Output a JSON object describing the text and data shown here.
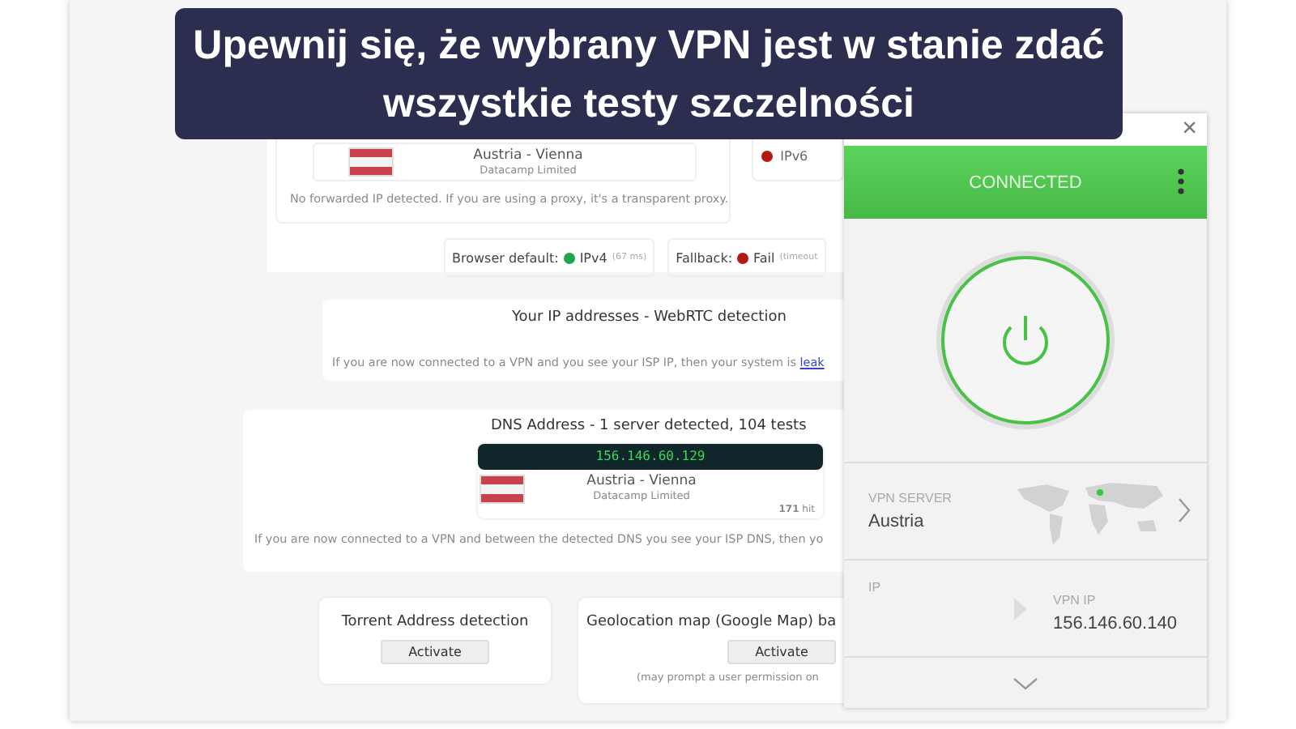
{
  "banner": {
    "text": "Upewnij się, że wybrany VPN jest w stanie zdać wszystkie testy szczelności"
  },
  "page": {
    "forwarded": {
      "location": "Austria - Vienna",
      "isp": "Datacamp Limited",
      "note": "No forwarded IP detected. If you are using a proxy, it's a transparent proxy.",
      "ipv6": {
        "label": "IPv6",
        "color": "#b3190f"
      }
    },
    "dns_test": [
      {
        "label": "Browser default:",
        "color": "#1fa64c",
        "value": "IPv4",
        "detail": "(67 ms)"
      },
      {
        "label": "Fallback:",
        "color": "#b3190f",
        "value": "Fail",
        "detail": "(timeout"
      }
    ],
    "webrtc": {
      "title": "Your IP addresses - WebRTC detection",
      "note": "If you are now connected to a VPN and you see your ISP IP, then your system is",
      "link": "leak"
    },
    "dns": {
      "title": "DNS Address - 1 server detected, 104 tests",
      "servers": [
        {
          "ip": "156.146.60.129",
          "location": "Austria - Vienna",
          "isp": "Datacamp Limited",
          "hits": "**171** hit"
        }
      ],
      "note": "If you are now connected to a VPN and between the detected DNS you see your ISP DNS, then yo"
    },
    "tools": [
      {
        "title": "Torrent Address detection",
        "button": "Activate"
      },
      {
        "title": "Geolocation map (Google Map) ba",
        "button": "Activate",
        "note": "(may prompt a user permission on"
      }
    ]
  },
  "vpn_app": {
    "close": "×",
    "status": "CONNECTED",
    "connected": true,
    "server_label": "VPN SERVER",
    "server": "Austria",
    "ip_label": "IP",
    "vpn_ip_label": "VPN IP",
    "vpn_ip": "156.146.60.140"
  }
}
